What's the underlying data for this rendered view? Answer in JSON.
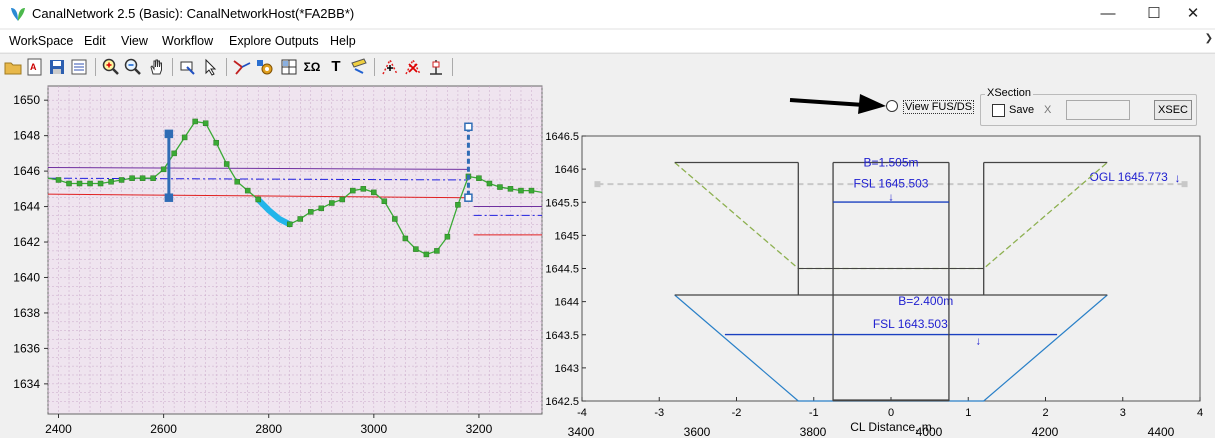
{
  "window": {
    "title": "CanalNetwork 2.5  (Basic): CanalNetworkHost(*FA2BB*)",
    "minimize": "—",
    "maximize": "☐",
    "close": "✕"
  },
  "menu": {
    "items": [
      "WorkSpace",
      "Edit",
      "View",
      "Workflow",
      "Explore Outputs",
      "Help"
    ],
    "overflow": "❯"
  },
  "toolbar": {
    "icons": [
      "open-folder-icon",
      "text-edit-icon",
      "save-icon",
      "properties-icon",
      "zoom-in-icon",
      "zoom-out-icon",
      "pan-hand-icon",
      "flag-select-icon",
      "pointer-select-icon",
      "network-edit-icon",
      "gear-network-icon",
      "grid-icon",
      "sigma-icon",
      "text-tool-icon",
      "pencil-draw-icon",
      "add-point-icon",
      "delete-point-icon",
      "node-icon"
    ],
    "sigma_label": "ΣΩ",
    "text_label": "T"
  },
  "xsection": {
    "group_title": "XSection",
    "save_label": "Save",
    "x_label": "X",
    "button_label": "XSEC",
    "view_fus_ds_label": "View FUS/DS"
  },
  "colors": {
    "profile_bg": "#efe4ef",
    "profile_line": "#3aaa35",
    "marker": "#2f6db5",
    "fsl_line": "#e02020",
    "ogl_line": "#7030a0",
    "dashdot": "#2020e0",
    "canal_section": "#444444",
    "cyan_segment": "#22b5ea",
    "xsec_blue": "#2060c0",
    "green_dashed": "#8db050"
  },
  "profile_chart": {
    "chart_data": {
      "type": "line",
      "x_ticks": [
        "2400",
        "2600",
        "2800",
        "3000",
        "3200"
      ],
      "y_ticks": [
        "1650",
        "1648",
        "1646",
        "1644",
        "1642",
        "1640",
        "1638",
        "1636",
        "1634"
      ],
      "xlim": [
        2380,
        3320
      ],
      "ylim": [
        1632.3,
        1650.8
      ],
      "grid": true,
      "ground_profile": {
        "x": [
          2380,
          2400,
          2420,
          2440,
          2460,
          2480,
          2500,
          2520,
          2540,
          2560,
          2580,
          2600,
          2620,
          2640,
          2660,
          2680,
          2700,
          2720,
          2740,
          2760,
          2780,
          2800,
          2820,
          2840,
          2860,
          2880,
          2900,
          2920,
          2940,
          2960,
          2980,
          3000,
          3020,
          3040,
          3060,
          3080,
          3100,
          3120,
          3140,
          3160,
          3180,
          3200,
          3220,
          3240,
          3260,
          3280,
          3300,
          3320
        ],
        "y": [
          1645.6,
          1645.5,
          1645.3,
          1645.3,
          1645.3,
          1645.3,
          1645.4,
          1645.5,
          1645.6,
          1645.6,
          1645.6,
          1646.1,
          1647.0,
          1647.9,
          1648.8,
          1648.7,
          1647.6,
          1646.4,
          1645.4,
          1644.9,
          1644.4,
          1643.8,
          1643.3,
          1643.0,
          1643.3,
          1643.7,
          1643.9,
          1644.2,
          1644.4,
          1644.9,
          1645.0,
          1644.8,
          1644.3,
          1643.3,
          1642.2,
          1641.6,
          1641.3,
          1641.5,
          1642.3,
          1644.1,
          1645.7,
          1645.6,
          1645.3,
          1645.1,
          1645.0,
          1644.9,
          1644.9,
          1644.8
        ]
      },
      "cyan_range": [
        2780,
        2840
      ],
      "ogl_line": {
        "x": [
          2380,
          3180
        ],
        "y": [
          1646.2,
          1646.1
        ]
      },
      "fsl_line": {
        "x": [
          2380,
          3180
        ],
        "y": [
          1644.7,
          1644.5
        ]
      },
      "dashdot_line": {
        "x": [
          2380,
          3180
        ],
        "y": [
          1645.6,
          1645.5
        ]
      },
      "right_segments": [
        {
          "series": "ogl",
          "x": [
            3190,
            3320
          ],
          "y": [
            1644.0,
            1644.0
          ]
        },
        {
          "series": "dashdot",
          "x": [
            3190,
            3320
          ],
          "y": [
            1643.5,
            1643.5
          ]
        },
        {
          "series": "fsl",
          "x": [
            3190,
            3320
          ],
          "y": [
            1642.4,
            1642.4
          ]
        }
      ],
      "markers": [
        {
          "x": 2610,
          "y_top": 1648.1,
          "y_bottom": 1644.5,
          "style": "solid"
        },
        {
          "x": 3180,
          "y_top": 1648.5,
          "y_bottom": 1644.5,
          "style": "dashed"
        }
      ]
    }
  },
  "xsection_chart": {
    "chart_data": {
      "type": "line",
      "xlabel": "CL Distance, m",
      "x_ticks": [
        "-4",
        "-3",
        "-2",
        "-1",
        "0",
        "1",
        "2",
        "3",
        "4"
      ],
      "y_ticks": [
        "1646.5",
        "1646",
        "1645.5",
        "1645",
        "1644.5",
        "1644",
        "1643.5",
        "1643",
        "1642.5"
      ],
      "xlim": [
        -4,
        4
      ],
      "ylim": [
        1642.5,
        1646.5
      ],
      "grid": false,
      "upper_section": {
        "bed_width_label": "B=1.505m",
        "fsl_label": "FSL 1645.503",
        "fsl_arrow": "↓",
        "fsl_level": 1645.503,
        "fsl_x": [
          -0.75,
          0.75
        ],
        "walls": [
          {
            "x": [
              -1.2,
              -1.2
            ],
            "y": [
              1646.1,
              1644.1
            ]
          },
          {
            "x": [
              -0.75,
              -0.75
            ],
            "y": [
              1646.1,
              1642.5
            ]
          },
          {
            "x": [
              0.75,
              0.75
            ],
            "y": [
              1646.1,
              1642.5
            ]
          },
          {
            "x": [
              1.2,
              1.2
            ],
            "y": [
              1646.1,
              1644.1
            ]
          }
        ],
        "top": [
          {
            "x": [
              -2.8,
              -1.2
            ],
            "y": [
              1646.1,
              1646.1
            ]
          },
          {
            "x": [
              -0.75,
              0.75
            ],
            "y": [
              1646.1,
              1646.1
            ]
          },
          {
            "x": [
              1.2,
              2.8
            ],
            "y": [
              1646.1,
              1646.1
            ]
          }
        ],
        "green_dashed": {
          "x": [
            -2.8,
            -1.2,
            1.2,
            2.8
          ],
          "y": [
            1646.1,
            1644.5,
            1644.5,
            1646.1
          ]
        }
      },
      "lower_section": {
        "bed_width_label": "B=2.400m",
        "fsl_label": "FSL 1643.503",
        "fsl_arrow": "↓",
        "fsl_level": 1643.503,
        "fsl_x": [
          -2.15,
          2.15
        ],
        "top": {
          "x": [
            -2.8,
            2.8
          ],
          "y": [
            1644.1,
            1644.1
          ]
        },
        "blue_sides": {
          "x": [
            -2.8,
            -1.2,
            1.2,
            2.8
          ],
          "y": [
            1644.1,
            1642.5,
            1642.5,
            1644.1
          ]
        }
      },
      "ogl": {
        "label": "OGL 1645.773",
        "arrow": "↓",
        "level": 1645.773,
        "x": [
          -3.8,
          3.8
        ]
      },
      "bottom_axis_overlap_ticks": [
        "3400",
        "3600",
        "3800",
        "4000",
        "4200",
        "4400"
      ]
    }
  }
}
